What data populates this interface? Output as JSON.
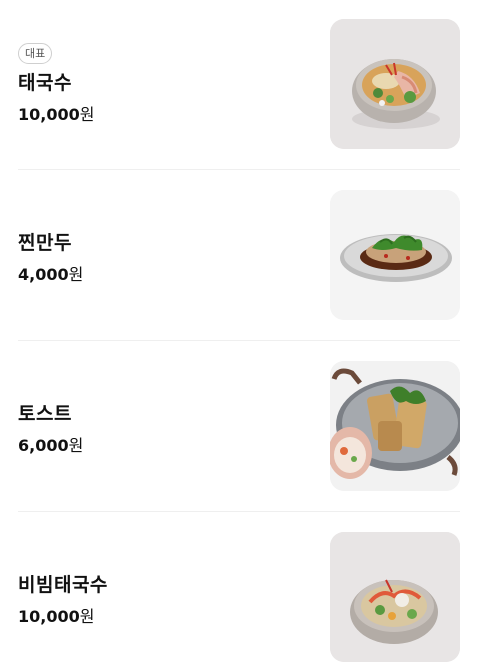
{
  "menu": {
    "items": [
      {
        "badge": "대표",
        "name": "태국수",
        "price": "10,000",
        "unit": "원",
        "image": "bowl-noodle-soup-image"
      },
      {
        "badge": "",
        "name": "찐만두",
        "price": "4,000",
        "unit": "원",
        "image": "steamed-dumpling-image"
      },
      {
        "badge": "",
        "name": "토스트",
        "price": "6,000",
        "unit": "원",
        "image": "toast-pan-image"
      },
      {
        "badge": "",
        "name": "비빔태국수",
        "price": "10,000",
        "unit": "원",
        "image": "mixed-noodle-image"
      }
    ]
  }
}
